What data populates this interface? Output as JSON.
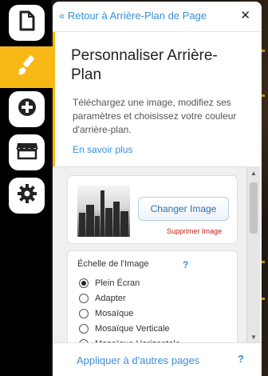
{
  "sidebar": {
    "items": [
      {
        "name": "pages",
        "icon": "page-icon"
      },
      {
        "name": "background",
        "icon": "brush-icon",
        "active": true
      },
      {
        "name": "add",
        "icon": "plus-circle-icon"
      },
      {
        "name": "store",
        "icon": "store-icon"
      },
      {
        "name": "settings",
        "icon": "gear-icon"
      }
    ],
    "accent_color": "#f8b816"
  },
  "panel": {
    "back_label": "Retour à Arrière-Plan de Page",
    "back_icon": "«",
    "close_label": "✕",
    "title": "Personnaliser Arrière-Plan",
    "description": "Téléchargez une image, modifiez ses paramètres et choisissez votre couleur d'arrière-plan.",
    "learn_more": "En savoir plus"
  },
  "image_card": {
    "change_button": "Changer Image",
    "remove_link": "Supprimer Image"
  },
  "scale": {
    "label": "Échelle de l'Image",
    "help": "?",
    "options": [
      {
        "label": "Plein Écran",
        "selected": true
      },
      {
        "label": "Adapter",
        "selected": false
      },
      {
        "label": "Mosaïque",
        "selected": false
      },
      {
        "label": "Mosaïque Verticale",
        "selected": false
      },
      {
        "label": "Mosaïque Horizontale",
        "selected": false
      }
    ]
  },
  "footer": {
    "apply_label": "Appliquer à d'autres pages",
    "help": "?"
  },
  "colors": {
    "link_blue": "#3a8fd8",
    "remove_red": "#b22222"
  }
}
